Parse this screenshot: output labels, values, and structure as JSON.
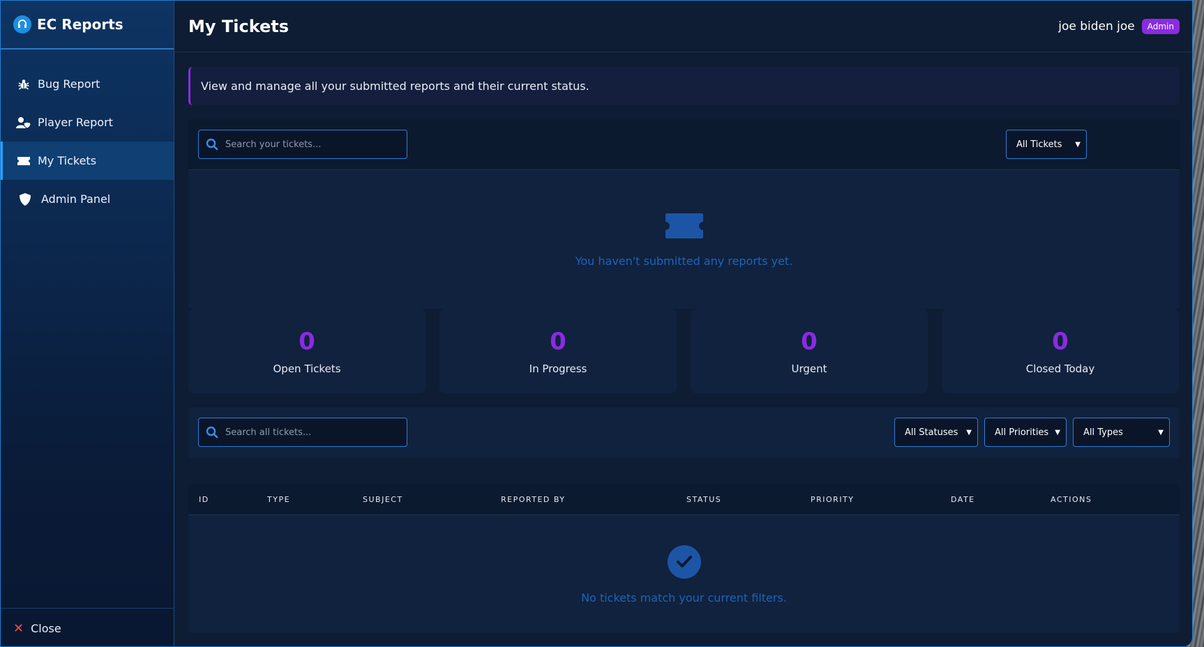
{
  "brand": {
    "title": "EC Reports"
  },
  "sidebar": {
    "items": [
      {
        "label": "Bug Report"
      },
      {
        "label": "Player Report"
      },
      {
        "label": "My Tickets"
      },
      {
        "label": "Admin Panel"
      }
    ],
    "close_label": "Close"
  },
  "header": {
    "title": "My Tickets",
    "user_name": "joe biden joe",
    "role": "Admin"
  },
  "banner": {
    "text": "View and manage all your submitted reports and their current status."
  },
  "my_tickets": {
    "search_placeholder": "Search your tickets...",
    "filter_selected": "All Tickets",
    "empty_text": "You haven't submitted any reports yet."
  },
  "stats": [
    {
      "value": "0",
      "label": "Open Tickets"
    },
    {
      "value": "0",
      "label": "In Progress"
    },
    {
      "value": "0",
      "label": "Urgent"
    },
    {
      "value": "0",
      "label": "Closed Today"
    }
  ],
  "all_tickets": {
    "search_placeholder": "Search all tickets...",
    "status_filter": "All Statuses",
    "priority_filter": "All Priorities",
    "type_filter": "All Types"
  },
  "table": {
    "columns": [
      "ID",
      "TYPE",
      "SUBJECT",
      "REPORTED BY",
      "STATUS",
      "PRIORITY",
      "DATE",
      "ACTIONS"
    ],
    "empty_text": "No tickets match your current filters."
  },
  "colors": {
    "accent": "#8a2be2",
    "primary_blue": "#2f7fd6",
    "close_red": "#ff4a4a"
  },
  "icons": {
    "brand": "headset-icon",
    "bug_report": "bug-icon",
    "player_report": "user-shield-icon",
    "my_tickets": "ticket-icon",
    "admin_panel": "shield-icon",
    "close": "close-icon",
    "search": "search-icon",
    "empty_tickets": "ticket-icon",
    "no_results": "check-circle-icon"
  }
}
